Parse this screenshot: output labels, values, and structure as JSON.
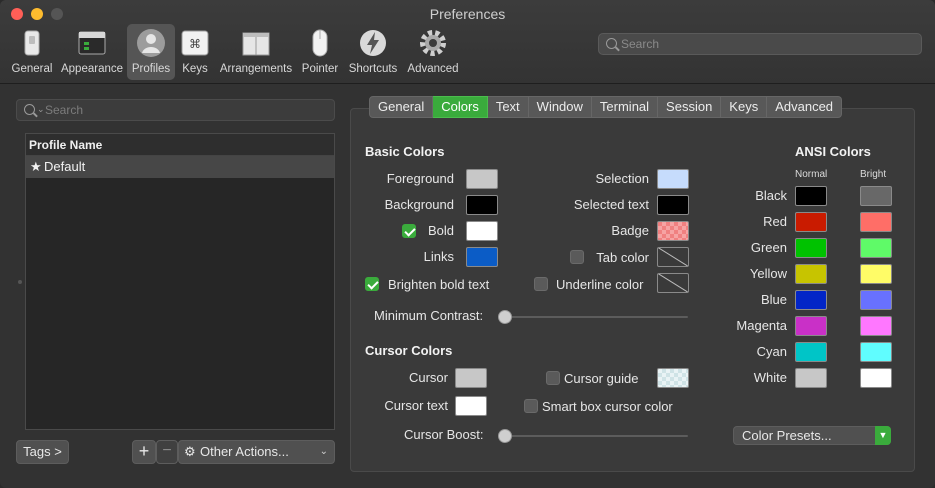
{
  "window": {
    "title": "Preferences"
  },
  "toolbar": {
    "items": [
      {
        "label": "General",
        "icon": "switch-icon"
      },
      {
        "label": "Appearance",
        "icon": "appearance-icon"
      },
      {
        "label": "Profiles",
        "icon": "person-icon",
        "selected": true
      },
      {
        "label": "Keys",
        "icon": "command-key-icon"
      },
      {
        "label": "Arrangements",
        "icon": "windows-icon"
      },
      {
        "label": "Pointer",
        "icon": "mouse-icon"
      },
      {
        "label": "Shortcuts",
        "icon": "lightning-icon"
      },
      {
        "label": "Advanced",
        "icon": "gear-icon"
      }
    ],
    "search_placeholder": "Search"
  },
  "profiles": {
    "search_placeholder": "Search",
    "column_header": "Profile Name",
    "rows": [
      {
        "name": "Default",
        "is_default": true
      }
    ],
    "tags_button": "Tags >",
    "add_button": "+",
    "remove_button": "−",
    "other_actions": "Other Actions..."
  },
  "tabs": [
    {
      "label": "General"
    },
    {
      "label": "Colors",
      "active": true
    },
    {
      "label": "Text"
    },
    {
      "label": "Window"
    },
    {
      "label": "Terminal"
    },
    {
      "label": "Session"
    },
    {
      "label": "Keys"
    },
    {
      "label": "Advanced"
    }
  ],
  "basic_colors": {
    "title": "Basic Colors",
    "foreground": {
      "label": "Foreground",
      "color": "#c7c7c7"
    },
    "background": {
      "label": "Background",
      "color": "#000000"
    },
    "bold": {
      "label": "Bold",
      "checked": true,
      "color": "#ffffff"
    },
    "links": {
      "label": "Links",
      "color": "#0b5cc6"
    },
    "selection": {
      "label": "Selection",
      "color": "#c6dcfc"
    },
    "selected_text": {
      "label": "Selected text",
      "color": "#000000"
    },
    "badge": {
      "label": "Badge",
      "color": "#f08080"
    },
    "tab_color": {
      "label": "Tab color",
      "checked": false
    },
    "brighten_bold": {
      "label": "Brighten bold text",
      "checked": true
    },
    "underline_color": {
      "label": "Underline color",
      "checked": false
    },
    "minimum_contrast": {
      "label": "Minimum Contrast:",
      "value": 0
    }
  },
  "cursor_colors": {
    "title": "Cursor Colors",
    "cursor": {
      "label": "Cursor",
      "color": "#c7c7c7"
    },
    "cursor_text": {
      "label": "Cursor text",
      "color": "#ffffff"
    },
    "cursor_guide": {
      "label": "Cursor guide",
      "checked": false
    },
    "smart_box": {
      "label": "Smart box cursor color",
      "checked": false
    },
    "cursor_boost": {
      "label": "Cursor Boost:",
      "value": 0
    }
  },
  "ansi_colors": {
    "title": "ANSI Colors",
    "normal_header": "Normal",
    "bright_header": "Bright",
    "rows": [
      {
        "name": "Black",
        "normal": "#000000",
        "bright": "#686868"
      },
      {
        "name": "Red",
        "normal": "#c91b00",
        "bright": "#ff6e67"
      },
      {
        "name": "Green",
        "normal": "#00c200",
        "bright": "#5ffa68"
      },
      {
        "name": "Yellow",
        "normal": "#c7c400",
        "bright": "#fffc67"
      },
      {
        "name": "Blue",
        "normal": "#0225c7",
        "bright": "#6871ff"
      },
      {
        "name": "Magenta",
        "normal": "#c930c7",
        "bright": "#ff77ff"
      },
      {
        "name": "Cyan",
        "normal": "#00c5c7",
        "bright": "#60fdff"
      },
      {
        "name": "White",
        "normal": "#c7c7c7",
        "bright": "#ffffff"
      }
    ],
    "presets_button": "Color Presets..."
  },
  "colors": {
    "accent": "#3aab3c"
  }
}
